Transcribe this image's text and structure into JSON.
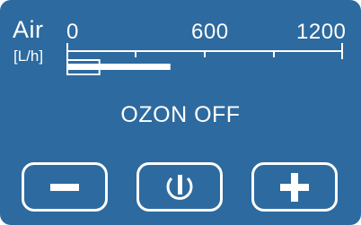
{
  "gauge": {
    "title": "Air",
    "unit": "[L/h]",
    "scale_min": 0,
    "scale_max": 1200,
    "tick_labels": [
      "0",
      "600",
      "1200"
    ],
    "bar_main_value": 450,
    "bar_marker_value": 140
  },
  "status": {
    "text": "OZON OFF"
  },
  "controls": {
    "decrease_icon": "minus-icon",
    "power_icon": "power-icon",
    "increase_icon": "plus-icon"
  },
  "colors": {
    "background": "#2d6a9f",
    "foreground": "#ffffff"
  }
}
